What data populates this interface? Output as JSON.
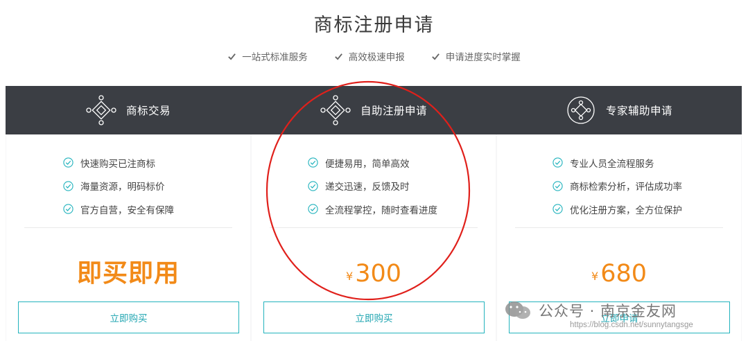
{
  "page": {
    "title": "商标注册申请",
    "features": [
      "一站式标准服务",
      "高效极速申报",
      "申请进度实时掌握"
    ]
  },
  "columns": [
    {
      "name": "商标交易",
      "icon": "diamond-network-icon",
      "benefits": [
        "快速购买已注商标",
        "海量资源，明码标价",
        "官方自营，安全有保障"
      ],
      "price_text": "即买即用",
      "currency": "",
      "button": "立即购买"
    },
    {
      "name": "自助注册申请",
      "icon": "diamond-network-icon",
      "benefits": [
        "便捷易用，简单高效",
        "递交迅速，反馈及时",
        "全流程掌控，随时查看进度"
      ],
      "price_text": "300",
      "currency": "¥",
      "button": "立即购买"
    },
    {
      "name": "专家辅助申请",
      "icon": "circle-network-icon",
      "benefits": [
        "专业人员全流程服务",
        "商标检索分析，评估成功率",
        "优化注册方案，全方位保护"
      ],
      "price_text": "680",
      "currency": "¥",
      "button": "立即申请"
    }
  ],
  "watermark": {
    "label": "公众号 · 南京金友网",
    "url": "https://blog.csdn.net/sunnytangsge"
  },
  "colors": {
    "header_band": "#3b3e44",
    "accent_teal": "#22b3bd",
    "price_orange": "#f28a18",
    "annotation_red": "#e0201b"
  }
}
